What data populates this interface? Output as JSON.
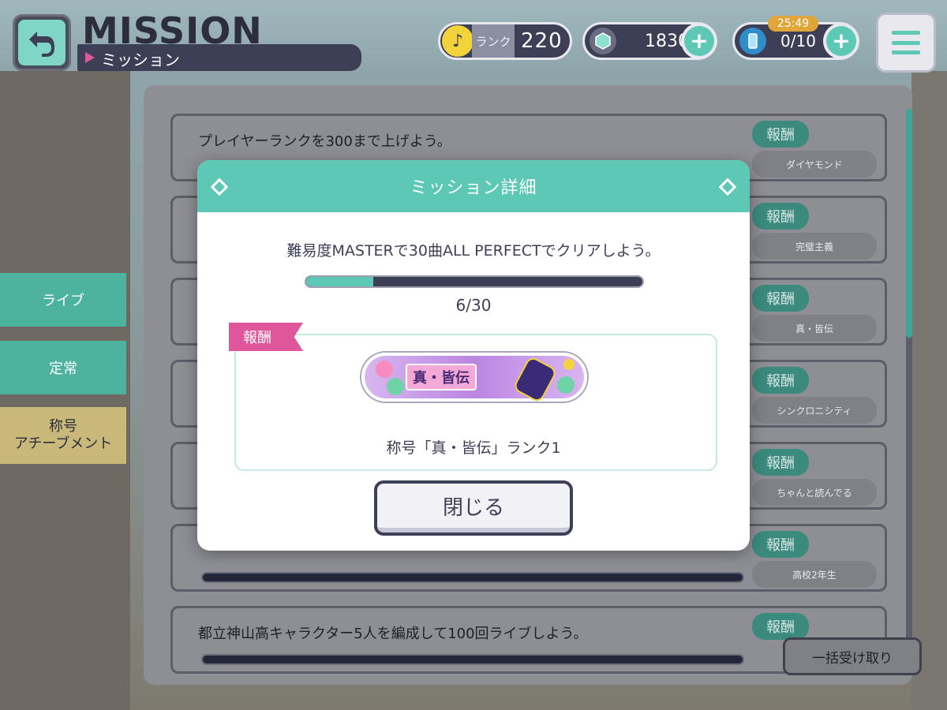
{
  "header": {
    "title": "MISSION",
    "subtitle": "ミッション",
    "rank_label": "ランク",
    "rank_value": "220",
    "gems": "1830",
    "energy": "0/10",
    "timer": "25:49",
    "plus": "+"
  },
  "sidebar": {
    "items": [
      {
        "label": "ライブ"
      },
      {
        "label": "定常"
      },
      {
        "label": "称号\nアチーブメント"
      }
    ]
  },
  "missions": [
    {
      "text": "プレイヤーランクを300まで上げよう。",
      "reward_tag": "報酬",
      "reward": "ダイヤモンド"
    },
    {
      "text": "",
      "reward_tag": "報酬",
      "reward": "完璧主義"
    },
    {
      "text": "",
      "reward_tag": "報酬",
      "reward": "真・皆伝"
    },
    {
      "text": "",
      "reward_tag": "報酬",
      "reward": "シンクロニシティ"
    },
    {
      "text": "",
      "reward_tag": "報酬",
      "reward": "ちゃんと読んでる"
    },
    {
      "text": "",
      "reward_tag": "報酬",
      "reward": "高校2年生"
    },
    {
      "text": "都立神山高キャラクター5人を編成して100回ライブしよう。",
      "reward_tag": "報酬",
      "reward": ""
    }
  ],
  "bulk_receive": "一括受け取り",
  "modal": {
    "title": "ミッション詳細",
    "mission_text": "難易度MASTERで30曲ALL PERFECTでクリアしよう。",
    "progress_text": "6/30",
    "progress_fraction": 0.2,
    "reward_label": "報酬",
    "badge_text": "真・皆伝",
    "reward_name": "称号「真・皆伝」ランク1",
    "close_label": "閉じる"
  }
}
